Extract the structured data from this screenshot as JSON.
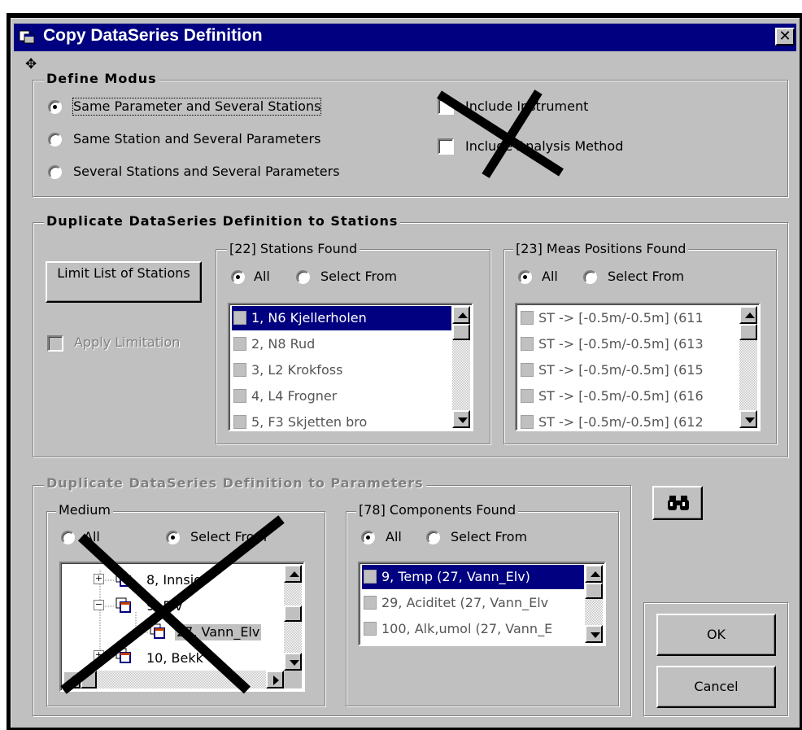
{
  "window": {
    "title": "Copy DataSeries Definition",
    "close_glyph": "✕",
    "cursor_glyph": "✥"
  },
  "define_modus": {
    "legend": "Define Modus",
    "options": [
      {
        "label": "Same Parameter and Several Stations",
        "selected": true
      },
      {
        "label": "Same Station and Several Parameters",
        "selected": false
      },
      {
        "label": "Several Stations and Several Parameters",
        "selected": false
      }
    ],
    "include_instrument": "Include Instrument",
    "include_analysis": "Include Analysis Method"
  },
  "stations_group": {
    "legend": "Duplicate DataSeries Definition to Stations",
    "limit_button": "Limit List of Stations",
    "apply_limitation": "Apply Limitation",
    "stations_found": {
      "legend": "[22] Stations Found",
      "all": "All",
      "select_from": "Select From",
      "items": [
        "1, N6 Kjellerholen",
        "2, N8 Rud",
        "3, L2 Krokfoss",
        "4, L4 Frogner",
        "5, F3 Skjetten bro"
      ]
    },
    "meas_positions": {
      "legend": "[23] Meas Positions Found",
      "all": "All",
      "select_from": "Select From",
      "items": [
        "ST -> [-0.5m/-0.5m] (611",
        "ST -> [-0.5m/-0.5m] (613",
        "ST -> [-0.5m/-0.5m] (615",
        "ST -> [-0.5m/-0.5m] (616",
        "ST -> [-0.5m/-0.5m] (612"
      ]
    }
  },
  "parameters_group": {
    "legend": "Duplicate DataSeries Definition to Parameters",
    "medium": {
      "legend": "Medium",
      "all": "All",
      "select_from": "Select From",
      "tree": [
        "8, Innsjø",
        "9, Elv",
        "27, Vann_Elv",
        "10, Bekk"
      ]
    },
    "components": {
      "legend": "[78] Components Found",
      "all": "All",
      "select_from": "Select From",
      "items": [
        "9, Temp (27, Vann_Elv)",
        "29, Aciditet (27, Vann_Elv",
        "100, Alk,umol (27, Vann_E"
      ]
    }
  },
  "buttons": {
    "ok": "OK",
    "cancel": "Cancel",
    "find_glyph": "🔍"
  }
}
